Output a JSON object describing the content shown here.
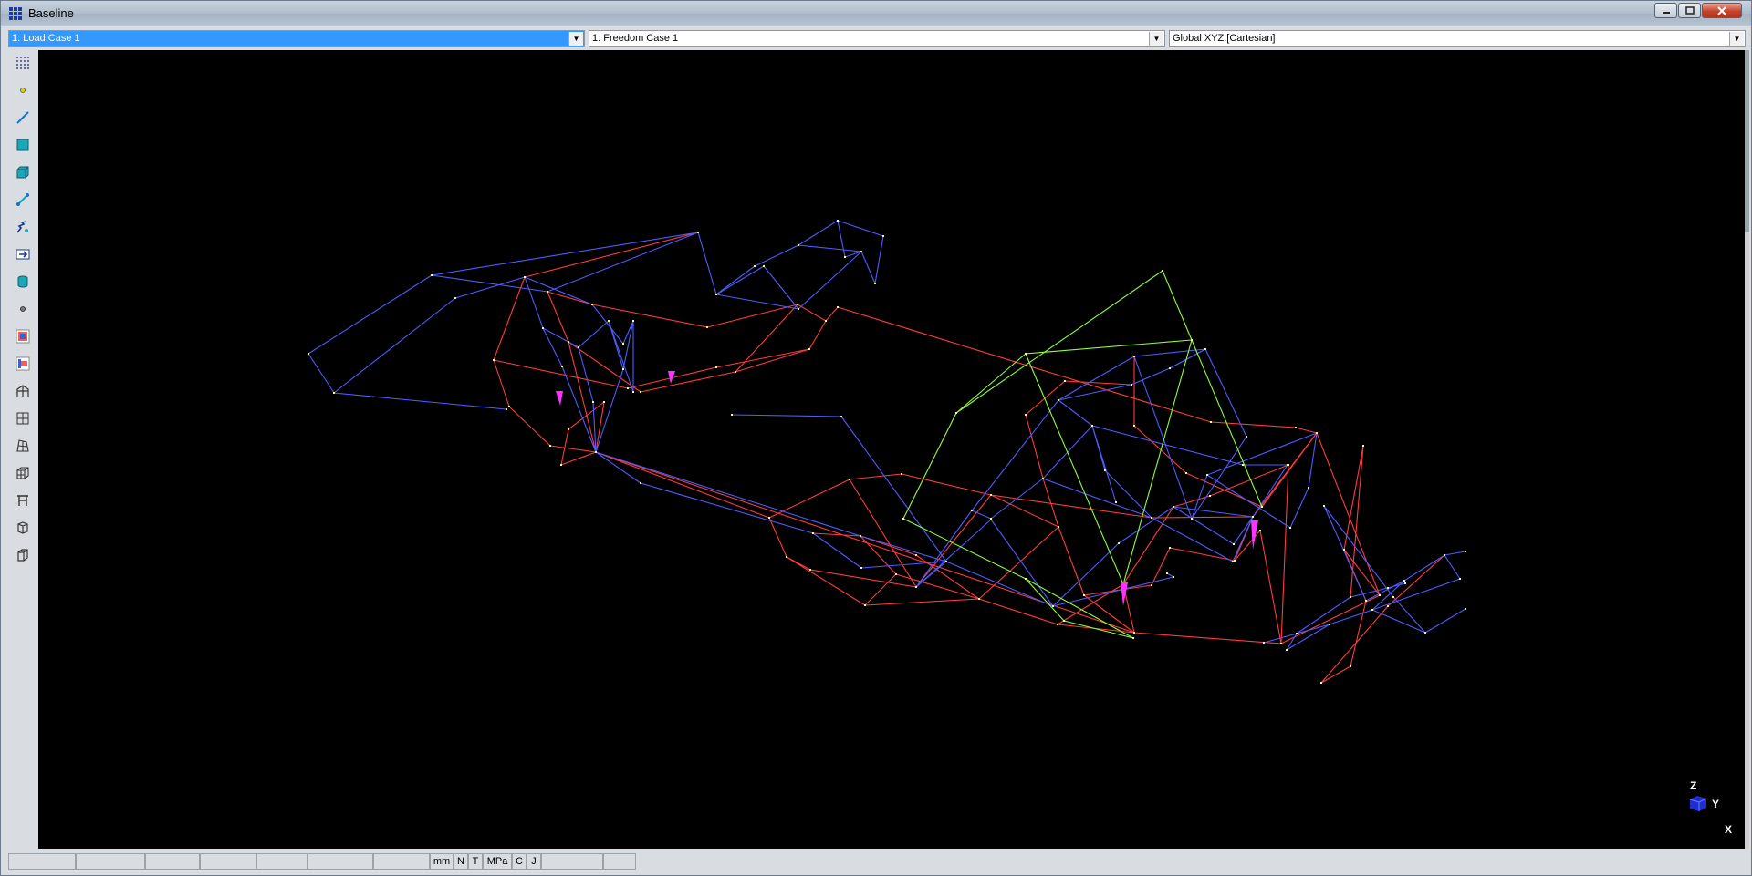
{
  "window": {
    "title": "Baseline"
  },
  "combos": {
    "load_case": "1: Load Case 1",
    "freedom_case": "1: Freedom Case 1",
    "coordinate_system": "Global XYZ:[Cartesian]"
  },
  "toolbar": {
    "items": [
      "dotgrid-icon",
      "node-icon",
      "beam-icon",
      "plate-icon",
      "brick-icon",
      "link-icon",
      "spring-icon",
      "arrow-box-icon",
      "cylinder-icon",
      "small-node-icon",
      "beam-attribute-icon",
      "plate-attribute-icon",
      "structure-icon",
      "grid-icon",
      "mesh-icon",
      "box-mesh-icon",
      "frame-icon",
      "cube-icon",
      "cube-side-icon"
    ]
  },
  "statusbar": {
    "units": [
      "mm",
      "N",
      "T",
      "MPa",
      "C",
      "J"
    ]
  },
  "triad": {
    "z": "Z",
    "y": "Y",
    "x": "X"
  },
  "colors": {
    "beam_red": "#ff3c3c",
    "beam_blue": "#4d5cff",
    "beam_green": "#8fff3c",
    "node": "#ffff66",
    "load": "#ff33ff",
    "viewport_bg": "#000000"
  }
}
